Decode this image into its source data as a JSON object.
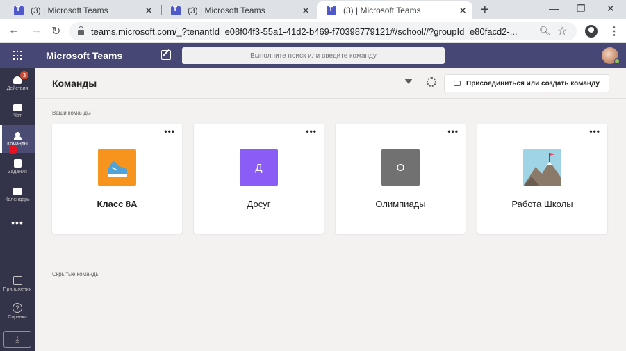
{
  "browser": {
    "tabs": [
      {
        "title": "(3) | Microsoft Teams"
      },
      {
        "title": "(3) | Microsoft Teams"
      },
      {
        "title": "(3) | Microsoft Teams"
      }
    ],
    "url": "teams.microsoft.com/_?tenantId=e08f04f3-55a1-41d2-b469-f70398779121#/school//?groupId=e80facd2-..."
  },
  "teams": {
    "app_title": "Microsoft Teams",
    "search_placeholder": "Выполните поиск или введите команду",
    "rail": [
      {
        "label": "Действия",
        "icon": "bell-icon",
        "badge": "3"
      },
      {
        "label": "Чат",
        "icon": "chat-icon"
      },
      {
        "label": "Команды",
        "icon": "teams-icon",
        "active": true
      },
      {
        "label": "Задания",
        "icon": "assignments-icon"
      },
      {
        "label": "Календарь",
        "icon": "calendar-icon"
      },
      {
        "label": "Приложения",
        "icon": "apps-icon"
      },
      {
        "label": "Справка",
        "icon": "help-icon"
      }
    ],
    "page_title": "Команды",
    "join_button": "Присоединиться или создать команду",
    "your_teams_label": "Ваши команды",
    "hidden_teams_label": "Скрытые команды",
    "cards": [
      {
        "name": "Класс 8А",
        "tile_letter": "",
        "tile_color": "#f7941d",
        "icon": "sneaker-icon",
        "bold": true
      },
      {
        "name": "Досуг",
        "tile_letter": "Д",
        "tile_color": "#8b5cf6"
      },
      {
        "name": "Олимпиады",
        "tile_letter": "О",
        "tile_color": "#717171"
      },
      {
        "name": "Работа Школы",
        "tile_letter": "",
        "tile_color": "#9fd3e6",
        "icon": "mountain-flag-icon"
      }
    ]
  },
  "colors": {
    "header": "#464775",
    "rail": "#33344a",
    "accent": "#6264a7"
  }
}
